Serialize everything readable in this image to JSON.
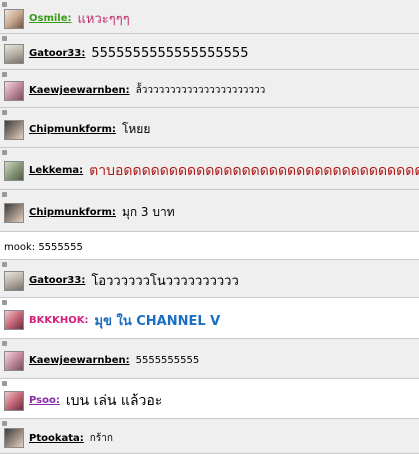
{
  "messages": [
    {
      "user": "Osmile:",
      "text": "แหวะๆๆๆ",
      "userColor": "#3a9a1a",
      "textColor": "#c0306a"
    },
    {
      "user": "Gatoor33:",
      "text": "5555555555555555555",
      "userColor": "#000000",
      "textColor": "#000000"
    },
    {
      "user": "Kaewjeewarnben:",
      "text": "ล้้วววววววววววววววววววววว",
      "userColor": "#000000",
      "textColor": "#000000"
    },
    {
      "user": "Chipmunkform:",
      "text": "โหยย",
      "userColor": "#000000",
      "textColor": "#000000"
    },
    {
      "user": "Lekkema:",
      "text": "ตาบอดดดดดดดดดดดดดดดดดดดดดดดดดดดดดดดดดดด",
      "userColor": "#000000",
      "textColor": "#b01818"
    },
    {
      "user": "Chipmunkform:",
      "text": "มุก 3 บาท",
      "userColor": "#000000",
      "textColor": "#000000"
    },
    {
      "user": "",
      "text": "mook: 5555555",
      "userColor": "#000000",
      "textColor": "#000000"
    },
    {
      "user": "Gatoor33:",
      "text": "โอววววววโนวววววววววว",
      "userColor": "#000000",
      "textColor": "#000000"
    },
    {
      "user": "BKKKHOK:",
      "text": "มุข ใน CHANNEL V",
      "userColor": "#d4207a",
      "textColor": "#1a6fc4"
    },
    {
      "user": "Kaewjeewarnben:",
      "text": "5555555555",
      "userColor": "#000000",
      "textColor": "#000000"
    },
    {
      "user": "Psoo:",
      "text": "เบน เล่น แล้วอะ",
      "userColor": "#8a2aa8",
      "textColor": "#000000"
    },
    {
      "user": "Ptookata:",
      "text": "กร้าก",
      "userColor": "#000000",
      "textColor": "#000000"
    }
  ]
}
